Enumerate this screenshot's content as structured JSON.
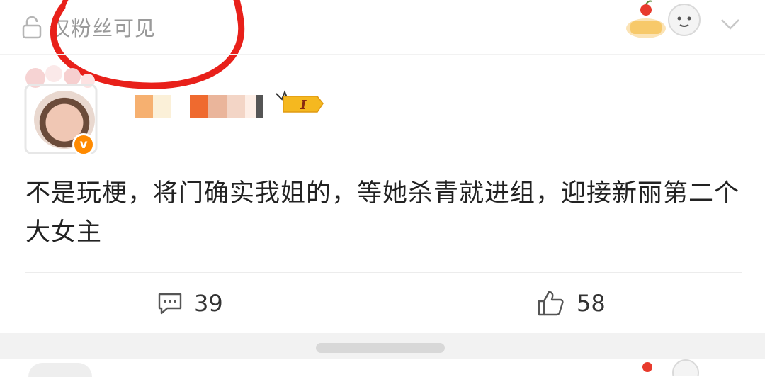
{
  "post": {
    "visibility_label": "仅粉丝可见",
    "author": {
      "level_badge": "I",
      "verified_badge": "v"
    },
    "content": "不是玩梗，将门确实我姐的，等她杀青就进组，迎接新丽第二个大女主",
    "actions": {
      "comments": "39",
      "likes": "58"
    }
  },
  "colors": {
    "verified_orange": "#ff8a00",
    "annotation_red": "#e8201a",
    "level_gold": "#f5b81f"
  }
}
